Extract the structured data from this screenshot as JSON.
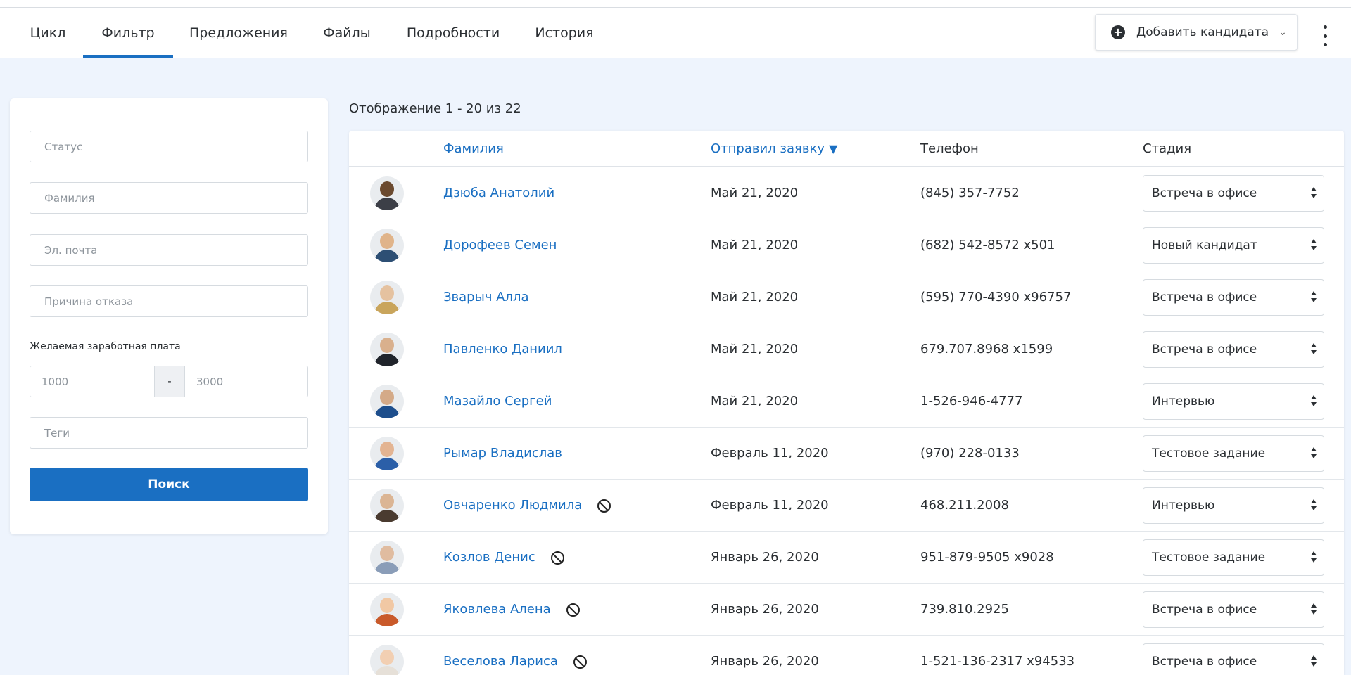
{
  "nav": {
    "tabs": [
      {
        "label": "Цикл"
      },
      {
        "label": "Фильтр"
      },
      {
        "label": "Предложения"
      },
      {
        "label": "Файлы"
      },
      {
        "label": "Подробности"
      },
      {
        "label": "История"
      }
    ],
    "active_tab": "Фильтр",
    "add_button_label": "Добавить кандидата"
  },
  "filter": {
    "status_placeholder": "Статус",
    "surname_placeholder": "Фамилия",
    "email_placeholder": "Эл. почта",
    "reason_placeholder": "Причина отказа",
    "salary_label": "Желаемая заработная плата",
    "salary_min_placeholder": "1000",
    "salary_separator": "-",
    "salary_max_placeholder": "3000",
    "tags_placeholder": "Теги",
    "search_button": "Поиск"
  },
  "table": {
    "showing": "Отображение 1 - 20 из 22",
    "columns": {
      "surname": "Фамилия",
      "applied": "Отправил заявку",
      "phone": "Телефон",
      "stage": "Стадия"
    },
    "sort": {
      "column": "applied",
      "direction": "desc"
    },
    "rows": [
      {
        "name": "Дзюба Анатолий",
        "date": "Май 21, 2020",
        "phone": "(845) 357-7752",
        "stage": "Встреча в офисе",
        "blocked": false
      },
      {
        "name": "Дорофеев Семен",
        "date": "Май 21, 2020",
        "phone": "(682) 542-8572 x501",
        "stage": "Новый кандидат",
        "blocked": false
      },
      {
        "name": "Зварыч Алла",
        "date": "Май 21, 2020",
        "phone": "(595) 770-4390 x96757",
        "stage": "Встреча в офисе",
        "blocked": false
      },
      {
        "name": "Павленко Даниил",
        "date": "Май 21, 2020",
        "phone": "679.707.8968 x1599",
        "stage": "Встреча в офисе",
        "blocked": false
      },
      {
        "name": "Мазайло Сергей",
        "date": "Май 21, 2020",
        "phone": "1-526-946-4777",
        "stage": "Интервью",
        "blocked": false
      },
      {
        "name": "Рымар Владислав",
        "date": "Февраль 11, 2020",
        "phone": "(970) 228-0133",
        "stage": "Тестовое задание",
        "blocked": false
      },
      {
        "name": "Овчаренко Людмила",
        "date": "Февраль 11, 2020",
        "phone": "468.211.2008",
        "stage": "Интервью",
        "blocked": true
      },
      {
        "name": "Козлов Денис",
        "date": "Январь 26, 2020",
        "phone": "951-879-9505 x9028",
        "stage": "Тестовое задание",
        "blocked": true
      },
      {
        "name": "Яковлева Алена",
        "date": "Январь 26, 2020",
        "phone": "739.810.2925",
        "stage": "Встреча в офисе",
        "blocked": true
      },
      {
        "name": "Веселова Лариса",
        "date": "Январь 26, 2020",
        "phone": "1-521-136-2317 x94533",
        "stage": "Встреча в офисе",
        "blocked": true
      }
    ]
  },
  "colors": {
    "accent": "#1a6fc2",
    "background": "#eef4fd"
  }
}
